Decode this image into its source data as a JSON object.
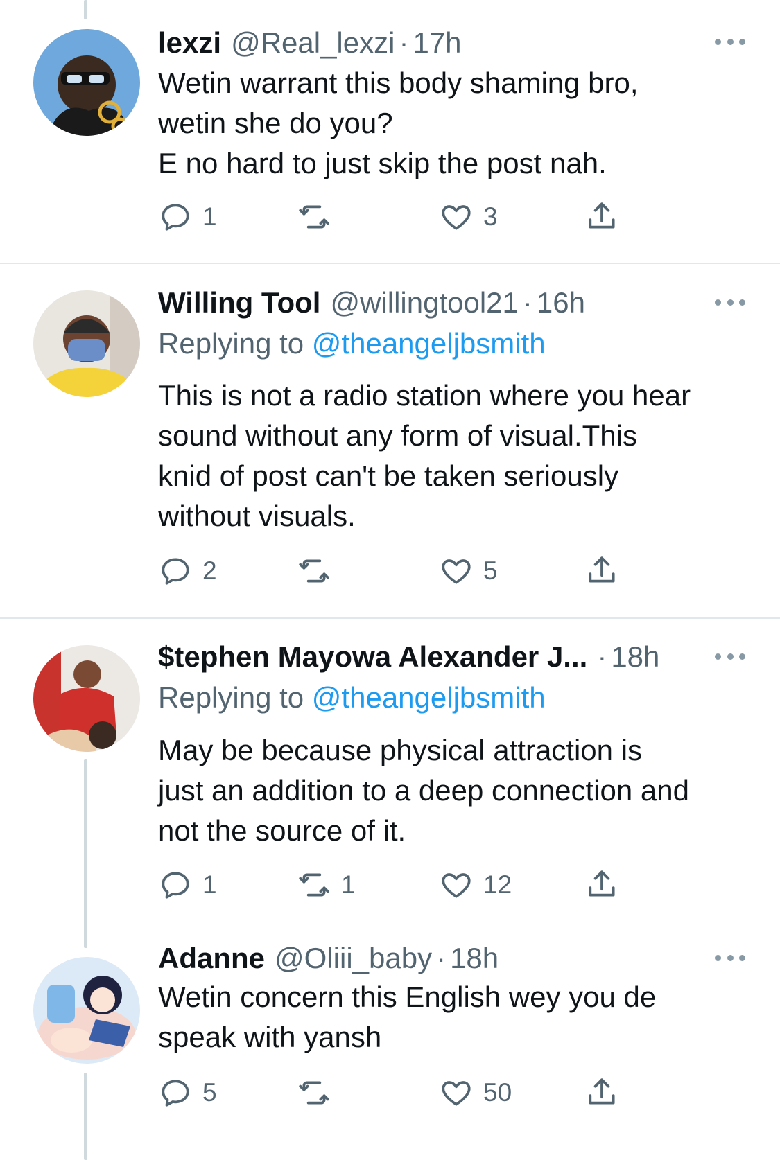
{
  "tweets": [
    {
      "name": "lexzi",
      "handle": "@Real_lexzi",
      "dot": "·",
      "time": "17h",
      "replying_label": "",
      "replying_to": "",
      "lines": [
        "Wetin warrant this body shaming bro,",
        "wetin she do you?",
        "E no hard to just skip the post nah."
      ],
      "reply_count": "1",
      "retweet_count": "",
      "like_count": "3"
    },
    {
      "name": "Willing Tool",
      "handle": "@willingtool21",
      "dot": "·",
      "time": "16h",
      "replying_label": "Replying to",
      "replying_to": "@theangeljbsmith",
      "lines": [
        "This is not a radio station where you hear",
        "sound without any form of visual.This",
        "knid of post can't be taken seriously",
        "without visuals."
      ],
      "reply_count": "2",
      "retweet_count": "",
      "like_count": "5"
    },
    {
      "name": "$tephen Mayowa Alexander J...",
      "handle": "",
      "dot": "·",
      "time": "18h",
      "replying_label": "Replying to",
      "replying_to": "@theangeljbsmith",
      "lines": [
        "May be because physical attraction is",
        "just an addition to a deep connection and",
        "not the source of it."
      ],
      "reply_count": "1",
      "retweet_count": "1",
      "like_count": "12"
    },
    {
      "name": "Adanne",
      "handle": "@Oliii_baby",
      "dot": "·",
      "time": "18h",
      "replying_label": "",
      "replying_to": "",
      "lines": [
        "Wetin concern this English wey you de",
        "speak with yansh"
      ],
      "reply_count": "5",
      "retweet_count": "",
      "like_count": "50"
    }
  ],
  "colors": {
    "text": "#0f1419",
    "secondary": "#536471",
    "link": "#1d9bf0",
    "thread_line": "#cfd9de",
    "divider": "#e1e8ed"
  },
  "icons": {
    "reply": "reply-icon",
    "retweet": "retweet-icon",
    "like": "heart-icon",
    "share": "share-icon",
    "more": "more-options-icon"
  }
}
